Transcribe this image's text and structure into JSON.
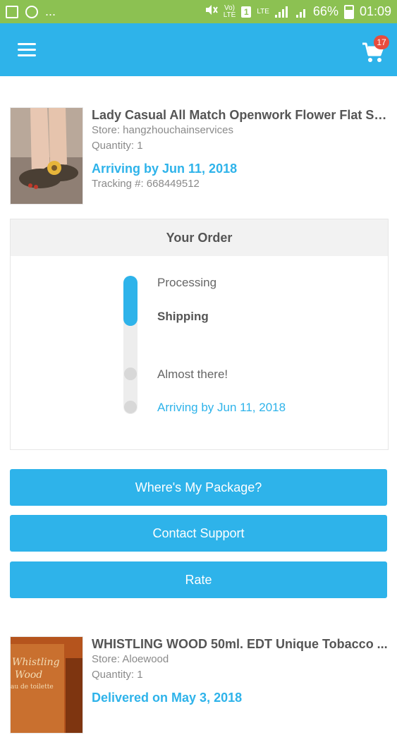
{
  "status_bar": {
    "dots": "...",
    "volte": "Vo)\nLTE",
    "sim": "1",
    "lte": "LTE",
    "battery": "66%",
    "time": "01:09"
  },
  "header": {
    "cart_count": "17"
  },
  "items": [
    {
      "title": "Lady Casual All Match Openwork Flower Flat Sl...",
      "store": "Store: hangzhouchainservices",
      "quantity": "Quantity: 1",
      "arrival": "Arriving by Jun 11, 2018",
      "tracking": "Tracking #: 668449512"
    },
    {
      "title": "WHISTLING WOOD 50ml. EDT Unique Tobacco ...",
      "store": "Store: Aloewood",
      "quantity": "Quantity: 1",
      "arrival": "Delivered on May 3, 2018",
      "image_text_1": "Whistling",
      "image_text_2": "Wood",
      "image_text_3": "au de toilette"
    }
  ],
  "order": {
    "title": "Your Order",
    "progress_fraction": 0.36,
    "steps": [
      {
        "label": "Processing"
      },
      {
        "label": "Shipping"
      },
      {
        "label": "Almost there!"
      },
      {
        "label": "Arriving by Jun 11, 2018"
      }
    ]
  },
  "actions": {
    "where_package": "Where's My Package?",
    "contact_support": "Contact Support",
    "rate": "Rate"
  },
  "colors": {
    "accent": "#2eb3ea",
    "status_bar": "#8cc152",
    "badge": "#e84c3d"
  }
}
